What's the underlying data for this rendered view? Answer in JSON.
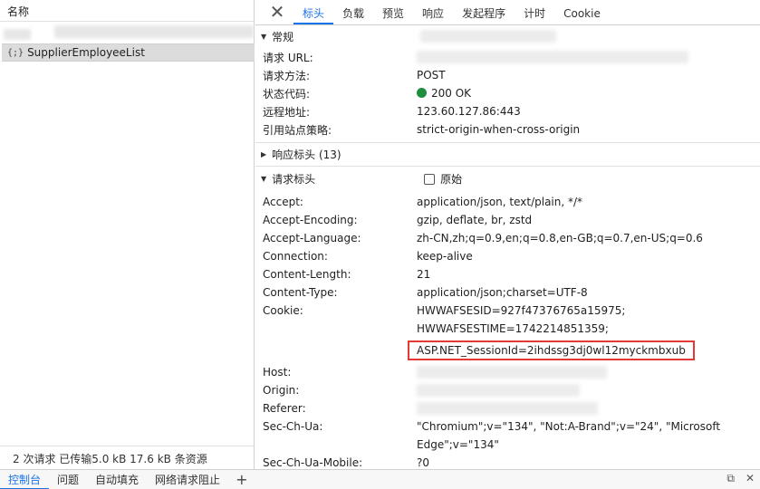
{
  "left": {
    "column_header": "名称",
    "request_icon": "{;}",
    "request_name": "SupplierEmployeeList",
    "status": "2 次请求  已传输5.0 kB  17.6 kB 条资源"
  },
  "tabs": [
    "标头",
    "负载",
    "预览",
    "响应",
    "发起程序",
    "计时",
    "Cookie"
  ],
  "general": {
    "title": "常规",
    "rows": [
      {
        "key": "请求 URL:",
        "value": ""
      },
      {
        "key": "请求方法:",
        "value": "POST"
      },
      {
        "key": "状态代码:",
        "value": "200 OK"
      },
      {
        "key": "远程地址:",
        "value": "123.60.127.86:443"
      },
      {
        "key": "引用站点策略:",
        "value": "strict-origin-when-cross-origin"
      }
    ]
  },
  "response_headers": {
    "title": "响应标头 (13)"
  },
  "request_headers": {
    "title": "请求标头",
    "raw_label": "原始",
    "rows": [
      {
        "key": "Accept:",
        "value": "application/json, text/plain, */*"
      },
      {
        "key": "Accept-Encoding:",
        "value": "gzip, deflate, br, zstd"
      },
      {
        "key": "Accept-Language:",
        "value": "zh-CN,zh;q=0.9,en;q=0.8,en-GB;q=0.7,en-US;q=0.6"
      },
      {
        "key": "Connection:",
        "value": "keep-alive"
      },
      {
        "key": "Content-Length:",
        "value": "21"
      },
      {
        "key": "Content-Type:",
        "value": "application/json;charset=UTF-8"
      }
    ],
    "cookie_key": "Cookie:",
    "cookie_lines": [
      "HWWAFSESID=927f47376765a15975;",
      "HWWAFSESTIME=1742214851359;",
      "ASP.NET_SessionId=2ihdssg3dj0wl12myckmbxub"
    ],
    "host_key": "Host:",
    "origin_key": "Origin:",
    "referer_key": "Referer:",
    "sec_ch_ua_key": "Sec-Ch-Ua:",
    "sec_ch_ua_lines": [
      "\"Chromium\";v=\"134\", \"Not:A-Brand\";v=\"24\", \"Microsoft",
      "Edge\";v=\"134\""
    ],
    "sec_ch_ua_mobile_key": "Sec-Ch-Ua-Mobile:",
    "sec_ch_ua_mobile_value": "?0"
  },
  "drawer": {
    "tabs": [
      "控制台",
      "问题",
      "自动填充",
      "网络请求阻止"
    ],
    "add_label": "+"
  },
  "colors": {
    "accent": "#1a73e8",
    "status_ok": "#1e8e3e",
    "highlight": "#e53935"
  }
}
